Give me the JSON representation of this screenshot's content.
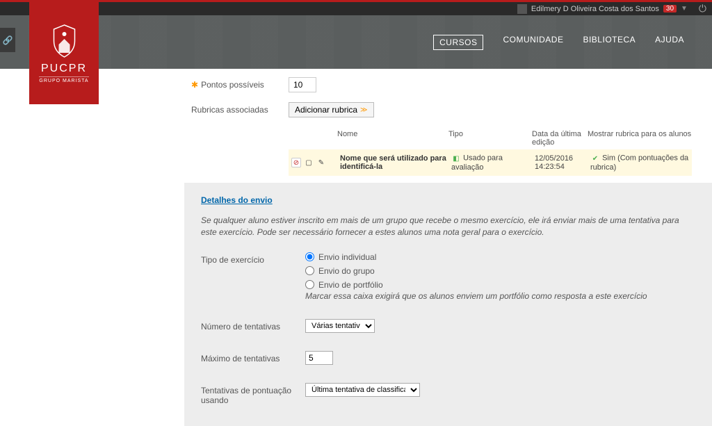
{
  "topbar": {
    "username": "Edilmery D Oliveira Costa dos Santos",
    "badge": "30"
  },
  "nav": {
    "cursos": "CURSOS",
    "comunidade": "COMUNIDADE",
    "biblioteca": "BIBLIOTECA",
    "ajuda": "AJUDA"
  },
  "brand": {
    "name": "PUCPR",
    "sub": "GRUPO MARISTA"
  },
  "fields": {
    "points_label": "Pontos possíveis",
    "points_value": "10",
    "rubrics_label": "Rubricas associadas",
    "add_rubric": "Adicionar rubrica"
  },
  "rubric_header": {
    "name": "Nome",
    "type": "Tipo",
    "date": "Data da última edição",
    "show": "Mostrar rubrica para os alunos"
  },
  "rubric_row": {
    "name": "Nome que será utilizado para identificá-la",
    "type": "Usado para avaliação",
    "date": "12/05/2016 14:23:54",
    "show": "Sim (Com pontuações da rubrica)"
  },
  "section": {
    "title": "Detalhes do envio",
    "desc": "Se qualquer aluno estiver inscrito em mais de um grupo que recebe o mesmo exercício, ele irá enviar mais de uma tentativa para este exercício. Pode ser necessário fornecer a estes alunos uma nota geral para o exercício.",
    "type_label": "Tipo de exercício",
    "radio_individual": "Envio individual",
    "radio_group": "Envio do grupo",
    "radio_portfolio": "Envio de portfólio",
    "portfolio_note": "Marcar essa caixa exigirá que os alunos enviem um portfólio como resposta a este exercício",
    "attempts_label": "Número de tentativas",
    "attempts_value": "Várias tentativas",
    "max_label": "Máximo de tentativas",
    "max_value": "5",
    "scoring_label": "Tentativas de pontuação usando",
    "scoring_value": "Última tentativa de classificação"
  }
}
